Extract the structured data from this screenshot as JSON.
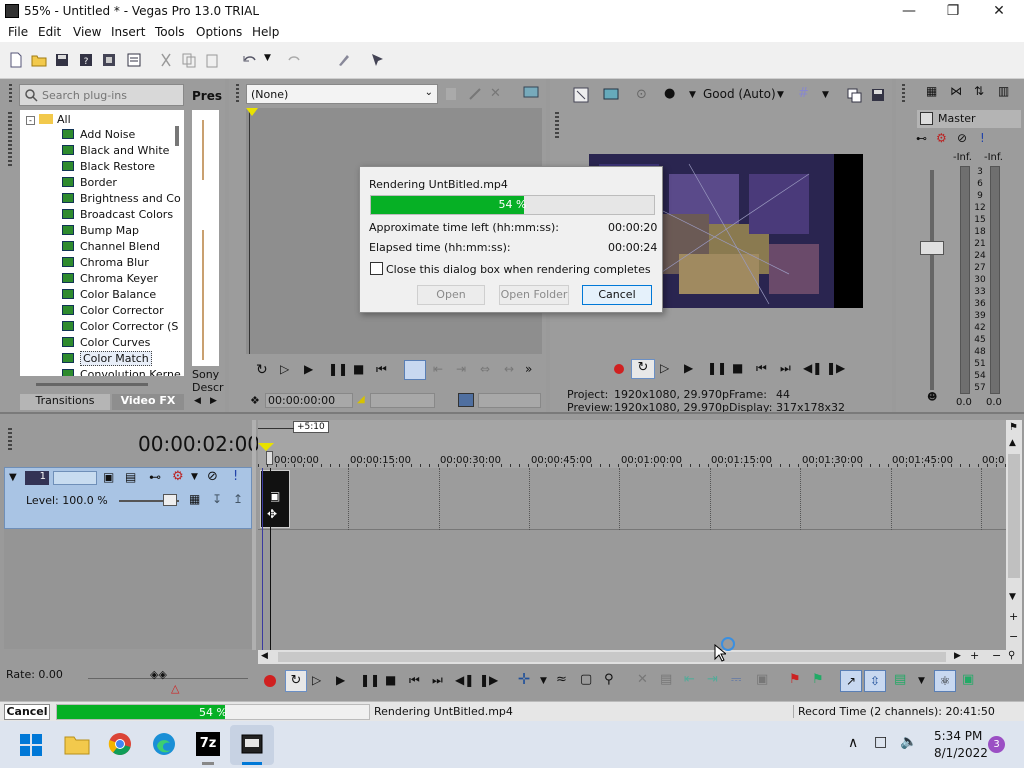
{
  "window": {
    "title": "55% - Untitled * - Vegas Pro 13.0 TRIAL"
  },
  "menu": [
    "File",
    "Edit",
    "View",
    "Insert",
    "Tools",
    "Options",
    "Help"
  ],
  "explorer": {
    "search_placeholder": "Search plug-ins",
    "pres_label": "Pres",
    "root": "All",
    "items": [
      "Add Noise",
      "Black and White",
      "Black Restore",
      "Border",
      "Brightness and Co",
      "Broadcast Colors",
      "Bump Map",
      "Channel Blend",
      "Chroma Blur",
      "Chroma Keyer",
      "Color Balance",
      "Color Corrector",
      "Color Corrector (S",
      "Color Curves",
      "Color Match",
      "Convolution Kerne"
    ],
    "selected": "Color Match",
    "tabs": [
      "Transitions",
      "Video FX"
    ],
    "sony_label": "Sony",
    "descr_label": "Descr"
  },
  "trimmer": {
    "dropdown_value": "(None)",
    "timecode": "00:00:00:00"
  },
  "preview": {
    "quality": "Good (Auto)",
    "project_label": "Project:",
    "project_value": "1920x1080, 29.970p",
    "preview_label": "Preview:",
    "preview_value": "1920x1080, 29.970p",
    "frame_label": "Frame:",
    "frame_value": "44",
    "display_label": "Display:",
    "display_value": "317x178x32"
  },
  "mixer": {
    "master_label": "Master",
    "db_left": "-Inf.",
    "db_right": "-Inf.",
    "scale": [
      "3",
      "6",
      "9",
      "12",
      "15",
      "18",
      "21",
      "24",
      "27",
      "30",
      "33",
      "36",
      "39",
      "42",
      "45",
      "48",
      "51",
      "54",
      "57"
    ],
    "bottom_left": "0.0",
    "bottom_right": "0.0"
  },
  "dialog": {
    "title": "Rendering UntBitled.mp4",
    "progress_label": "54 %",
    "progress": 0.54,
    "time_left_label": "Approximate time left (hh:mm:ss):",
    "time_left_value": "00:00:20",
    "elapsed_label": "Elapsed time (hh:mm:ss):",
    "elapsed_value": "00:00:24",
    "checkbox_label": "Close this dialog box when rendering completes",
    "open_label": "Open",
    "open_folder_label": "Open Folder",
    "cancel_label": "Cancel"
  },
  "timeline": {
    "timecode": "00:00:02:00",
    "region_label": "+5:10",
    "ticks": [
      "00:00:00",
      "00:00:15:00",
      "00:00:30:00",
      "00:00:45:00",
      "00:01:00:00",
      "00:01:15:00",
      "00:01:30:00",
      "00:01:45:00",
      "00:02"
    ],
    "track_number": "1",
    "level_label": "Level: 100.0 %",
    "rate_label": "Rate: 0.00"
  },
  "status": {
    "cancel_label": "Cancel",
    "progress_label": "54 %",
    "progress": 0.54,
    "message": "Rendering UntBitled.mp4",
    "record_time": "Record Time (2 channels): 20:41:50"
  },
  "taskbar": {
    "time": "5:34 PM",
    "date": "8/1/2022",
    "badge": "3",
    "app_7z": "7z"
  },
  "colors": {
    "progress_green": "#06b025",
    "accent_blue": "#0078d7",
    "track_blue": "#a9c4e4"
  }
}
